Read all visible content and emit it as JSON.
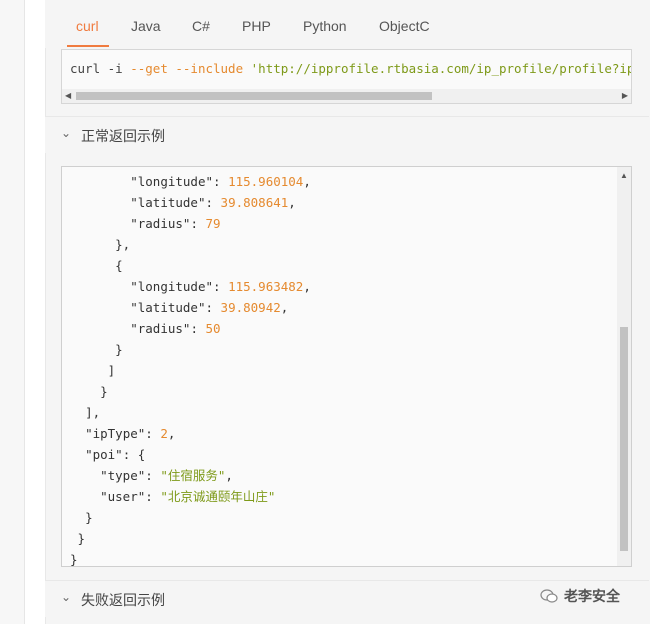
{
  "tabs": [
    {
      "label": "curl",
      "active": true
    },
    {
      "label": "Java",
      "active": false
    },
    {
      "label": "C#",
      "active": false
    },
    {
      "label": "PHP",
      "active": false
    },
    {
      "label": "Python",
      "active": false
    },
    {
      "label": "ObjectC",
      "active": false
    }
  ],
  "curl_line": {
    "cmd": "curl -i ",
    "opt": "--get --include ",
    "url": "'http://ipprofile.rtbasia.com/ip_profile/profile?ip=ip'"
  },
  "sections": {
    "normal_title": "正常返回示例",
    "failure_title": "失败返回示例"
  },
  "json_lines": [
    {
      "indent": "        ",
      "key": "\"longitude\"",
      "sep": ": ",
      "value": "115.960104",
      "vtype": "num",
      "tail": ","
    },
    {
      "indent": "        ",
      "key": "\"latitude\"",
      "sep": ": ",
      "value": "39.808641",
      "vtype": "num",
      "tail": ","
    },
    {
      "indent": "        ",
      "key": "\"radius\"",
      "sep": ": ",
      "value": "79",
      "vtype": "num",
      "tail": ""
    },
    {
      "indent": "      ",
      "key": "",
      "sep": "",
      "value": "",
      "vtype": "",
      "tail": "},"
    },
    {
      "indent": "      ",
      "key": "",
      "sep": "",
      "value": "",
      "vtype": "",
      "tail": "{"
    },
    {
      "indent": "        ",
      "key": "\"longitude\"",
      "sep": ": ",
      "value": "115.963482",
      "vtype": "num",
      "tail": ","
    },
    {
      "indent": "        ",
      "key": "\"latitude\"",
      "sep": ": ",
      "value": "39.80942",
      "vtype": "num",
      "tail": ","
    },
    {
      "indent": "        ",
      "key": "\"radius\"",
      "sep": ": ",
      "value": "50",
      "vtype": "num",
      "tail": ""
    },
    {
      "indent": "      ",
      "key": "",
      "sep": "",
      "value": "",
      "vtype": "",
      "tail": "}"
    },
    {
      "indent": "     ",
      "key": "",
      "sep": "",
      "value": "",
      "vtype": "",
      "tail": "]"
    },
    {
      "indent": "    ",
      "key": "",
      "sep": "",
      "value": "",
      "vtype": "",
      "tail": "}"
    },
    {
      "indent": "  ",
      "key": "",
      "sep": "",
      "value": "",
      "vtype": "",
      "tail": "],"
    },
    {
      "indent": "  ",
      "key": "\"ipType\"",
      "sep": ": ",
      "value": "2",
      "vtype": "num",
      "tail": ","
    },
    {
      "indent": "  ",
      "key": "\"poi\"",
      "sep": ": ",
      "value": "",
      "vtype": "",
      "tail": "{"
    },
    {
      "indent": "    ",
      "key": "\"type\"",
      "sep": ": ",
      "value": "\"住宿服务\"",
      "vtype": "str",
      "tail": ","
    },
    {
      "indent": "    ",
      "key": "\"user\"",
      "sep": ": ",
      "value": "\"北京诚通颐年山庄\"",
      "vtype": "str",
      "tail": ""
    },
    {
      "indent": "  ",
      "key": "",
      "sep": "",
      "value": "",
      "vtype": "",
      "tail": "}"
    },
    {
      "indent": " ",
      "key": "",
      "sep": "",
      "value": "",
      "vtype": "",
      "tail": "}"
    },
    {
      "indent": "",
      "key": "",
      "sep": "",
      "value": "",
      "vtype": "",
      "tail": "}"
    }
  ],
  "watermark": {
    "text": "老李安全",
    "icon": "wechat-icon"
  },
  "colors": {
    "accent": "#f07b3f",
    "number": "#e58a2f",
    "string": "#7e9a19"
  }
}
